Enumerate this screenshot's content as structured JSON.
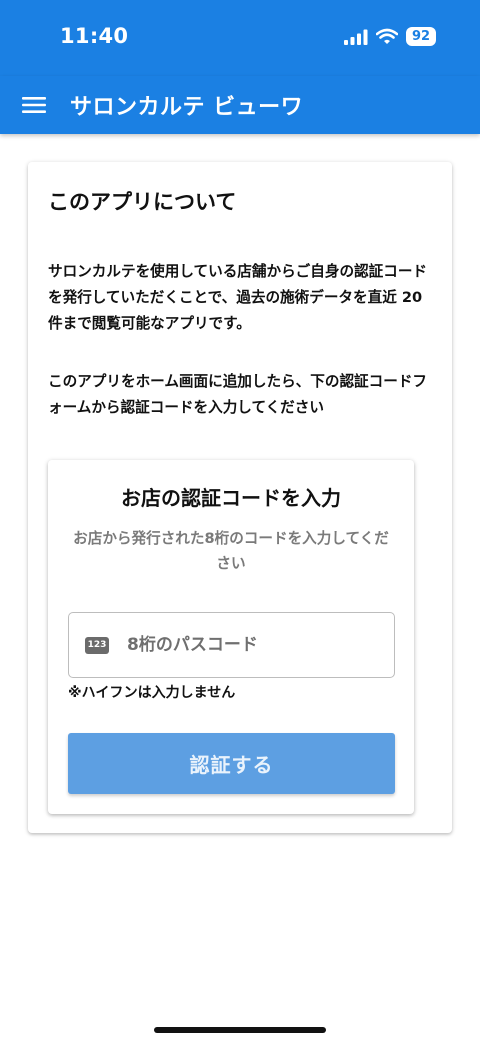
{
  "status_bar": {
    "time": "11:40",
    "battery": "92",
    "icons": [
      "signal-icon",
      "wifi-icon",
      "battery-icon"
    ]
  },
  "app_bar": {
    "title": "サロンカルテ ビューワ",
    "menu_icon": "hamburger-menu-icon"
  },
  "about": {
    "heading": "このアプリについて",
    "paragraph_1": "サロンカルテを使用している店舗からご自身の認証コードを発行していただくことで、過去の施術データを直近 20件まで閲覧可能なアプリです。",
    "paragraph_2": "このアプリをホーム画面に追加したら、下の認証コードフォームから認証コードを入力してください"
  },
  "auth_form": {
    "title": "お店の認証コードを入力",
    "subtitle": "お店から発行された8桁のコードを入力してください",
    "input_icon": "123",
    "input_placeholder": "8桁のパスコード",
    "input_value": "",
    "hint": "※ハイフンは入力しません",
    "submit_label": "認証する"
  },
  "colors": {
    "primary": "#1b80e3",
    "button_disabled": "#5d9fe2",
    "subtitle_text": "#7a7a7a"
  }
}
